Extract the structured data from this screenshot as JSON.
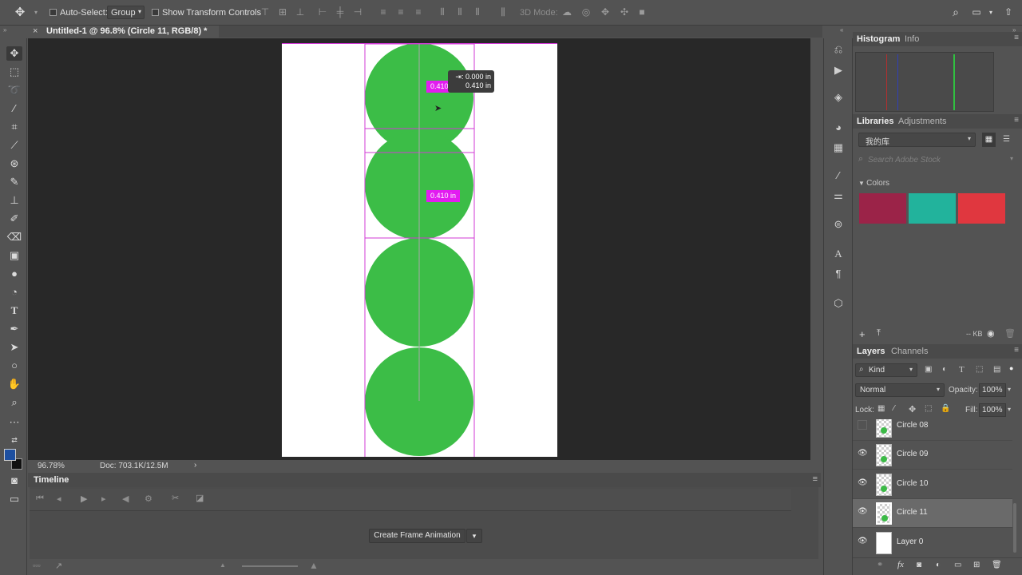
{
  "options_bar": {
    "auto_select_label": "Auto-Select:",
    "auto_select_value": "Group",
    "transform_controls_label": "Show Transform Controls",
    "mode_3d_label": "3D Mode:"
  },
  "document_tab": {
    "title": "Untitled-1 @ 96.8% (Circle 11, RGB/8) *"
  },
  "canvas": {
    "measure_top": "0.410 in",
    "measure_mid": "0.410 in",
    "tooltip_line1": "⇥: 0.000 in",
    "tooltip_line2": "0.410 in",
    "circle_color": "#3cbd47",
    "guide_color": "#d13ad6"
  },
  "status_bar": {
    "zoom": "96.78%",
    "doc_info": "Doc: 703.1K/12.5M"
  },
  "timeline": {
    "title": "Timeline",
    "create_button": "Create Frame Animation"
  },
  "histogram_panel": {
    "tab_active": "Histogram",
    "tab_inactive": "Info"
  },
  "libraries_panel": {
    "tab_active": "Libraries",
    "tab_inactive": "Adjustments",
    "library_name": "我的库",
    "search_placeholder": "Search Adobe Stock",
    "colors_label": "Colors",
    "swatches": [
      "#9b2348",
      "#22b39c",
      "#e0373f"
    ],
    "size_label": "-- KB"
  },
  "layers_panel": {
    "tab_active": "Layers",
    "tab_inactive": "Channels",
    "filter_kind": "Kind",
    "blend_mode": "Normal",
    "opacity_label": "Opacity:",
    "opacity_value": "100%",
    "lock_label": "Lock:",
    "fill_label": "Fill:",
    "fill_value": "100%",
    "layers": [
      {
        "name": "Circle 08",
        "visible": false,
        "selected": false
      },
      {
        "name": "Circle 09",
        "visible": true,
        "selected": false
      },
      {
        "name": "Circle 10",
        "visible": true,
        "selected": false
      },
      {
        "name": "Circle 11",
        "visible": true,
        "selected": true
      },
      {
        "name": "Layer 0",
        "visible": true,
        "selected": false
      }
    ]
  }
}
